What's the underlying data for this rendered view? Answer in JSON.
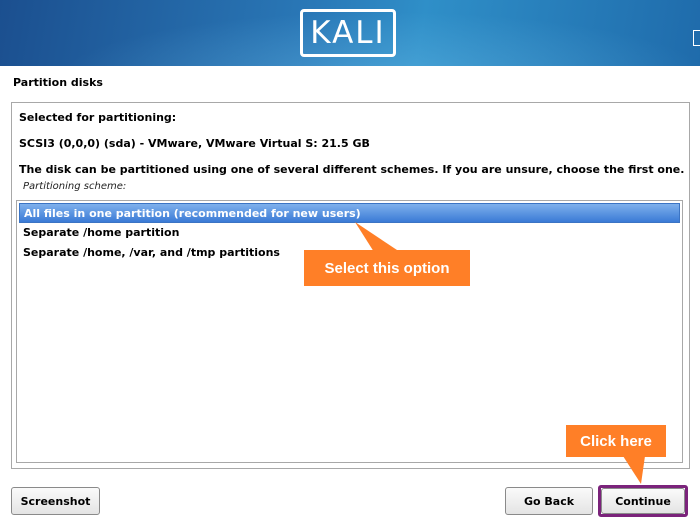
{
  "banner": {
    "logo_text": "KALI"
  },
  "page": {
    "title": "Partition disks"
  },
  "content": {
    "selected_heading": "Selected for partitioning:",
    "disk": "SCSI3 (0,0,0) (sda) - VMware, VMware Virtual S: 21.5 GB",
    "description": "The disk can be partitioned using one of several different schemes. If you are unsure, choose the first one.",
    "scheme_label": "Partitioning scheme:"
  },
  "options": [
    {
      "label": "All files in one partition (recommended for new users)",
      "selected": true
    },
    {
      "label": "Separate /home partition",
      "selected": false
    },
    {
      "label": "Separate /home, /var, and /tmp partitions",
      "selected": false
    }
  ],
  "annotations": {
    "select_option": "Select this option",
    "click_here": "Click here"
  },
  "buttons": {
    "screenshot": "Screenshot",
    "go_back": "Go Back",
    "continue": "Continue"
  },
  "colors": {
    "banner": "#2a79b8",
    "selection": "#3a7ad6",
    "callout": "#ff7f27",
    "highlight_border": "#7b237b"
  }
}
